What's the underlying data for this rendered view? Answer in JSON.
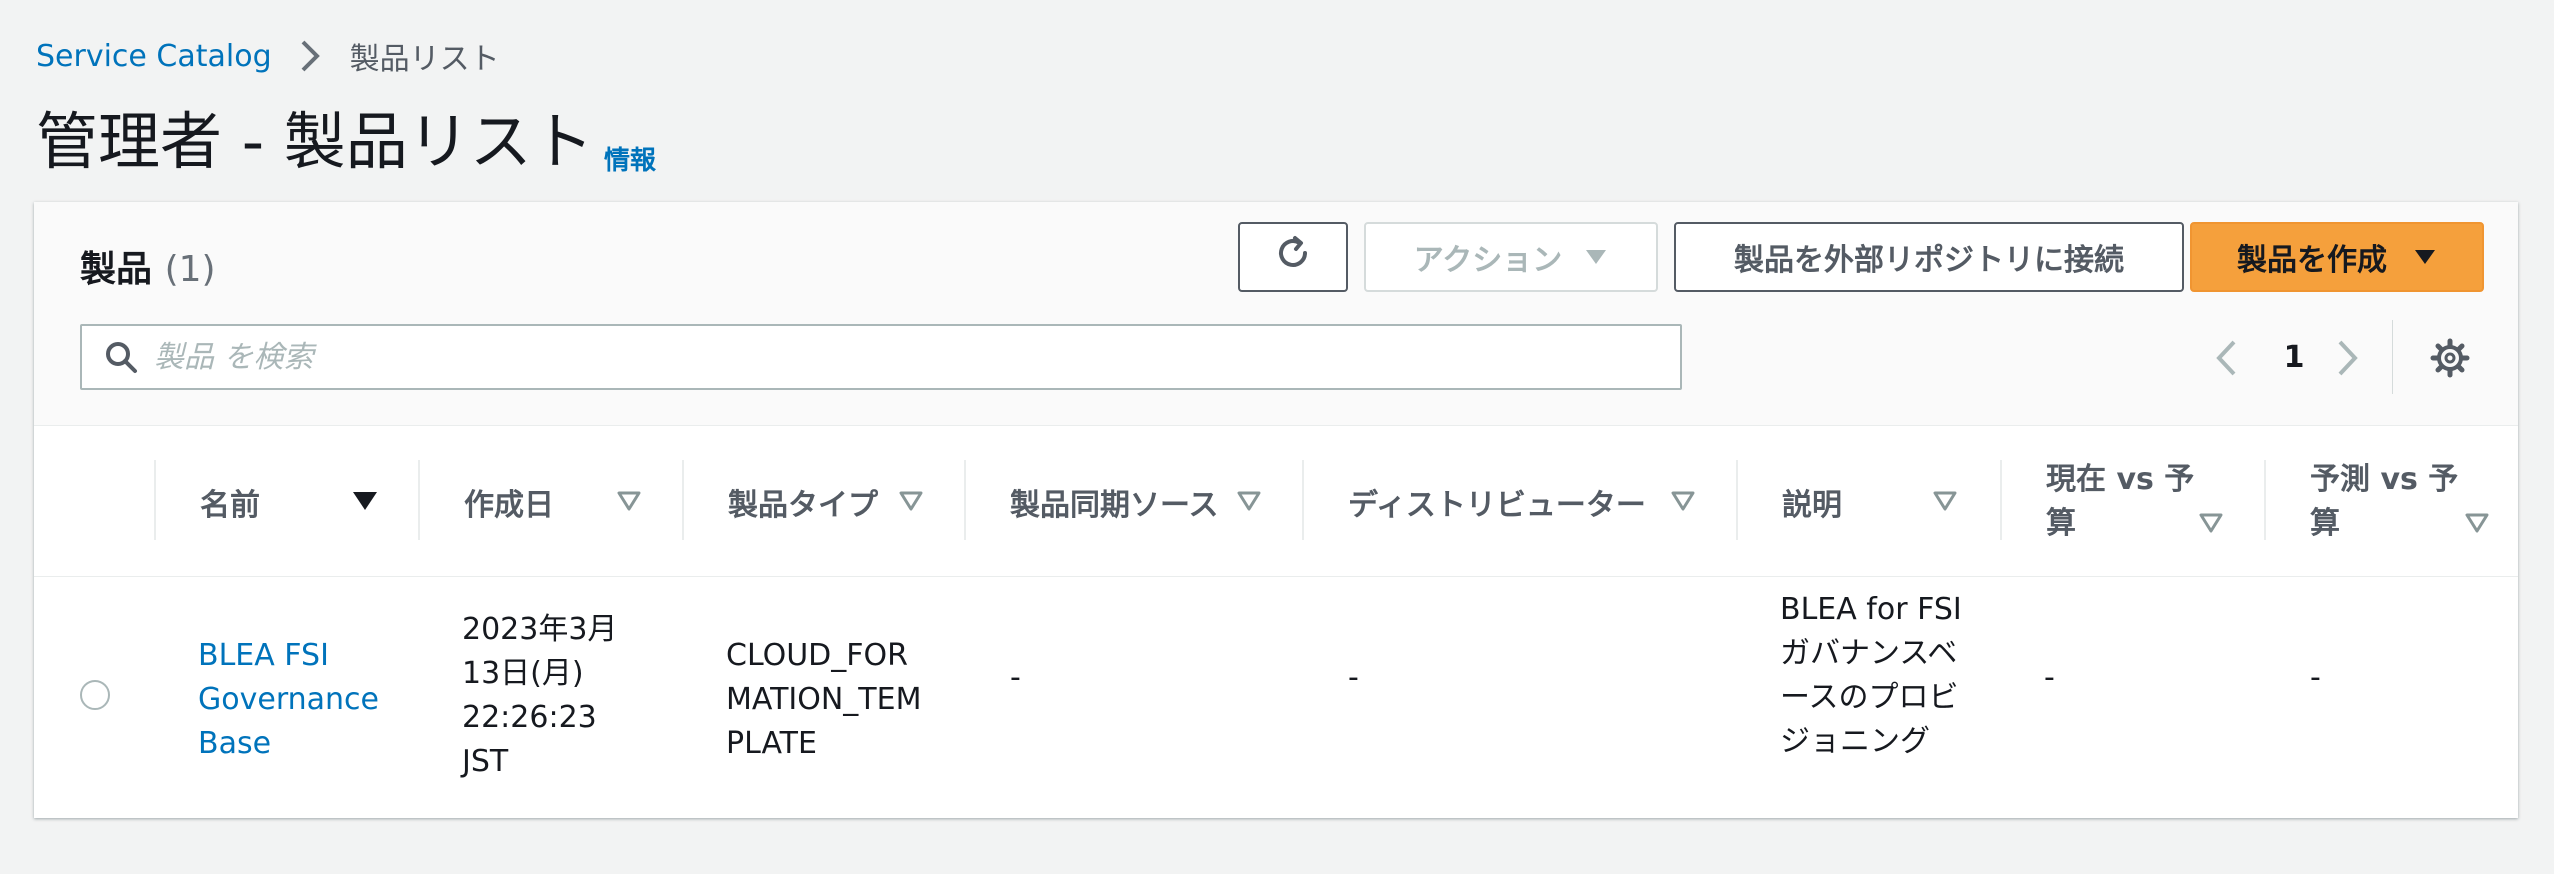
{
  "breadcrumb": {
    "root": "Service Catalog",
    "current": "製品リスト"
  },
  "page": {
    "title": "管理者 - 製品リスト",
    "info": "情報"
  },
  "products": {
    "title": "製品",
    "count": "(1)",
    "actions": {
      "action_label": "アクション",
      "connect_label": "製品を外部リポジトリに接続",
      "create_label": "製品を作成"
    },
    "search": {
      "placeholder": "製品 を検索"
    },
    "pagination": {
      "current_page": "1"
    },
    "columns": [
      {
        "label": "名前",
        "sorted": "descending"
      },
      {
        "label": "作成日"
      },
      {
        "label": "製品タイプ"
      },
      {
        "label": "製品同期ソース"
      },
      {
        "label": "ディストリビューター"
      },
      {
        "label": "説明"
      },
      {
        "label": "現在 vs 予算"
      },
      {
        "label": "予測 vs 予算"
      }
    ],
    "rows": [
      {
        "name": "BLEA FSI Governance Base",
        "created": "2023年3月13日(月) 22:26:23 JST",
        "type": "CLOUD_FORMATION_TEMPLATE",
        "sync_source": "-",
        "distributor": "-",
        "description": "BLEA for FSI ガバナンスベースのプロビジョニング",
        "current_vs_budget": "-",
        "forecast_vs_budget": "-",
        "selected": false
      }
    ]
  },
  "colors": {
    "link": "#0073bb",
    "primary_button": "#f5a03c",
    "page_background": "#f2f3f3",
    "text": "#16191f",
    "muted_text": "#545b64"
  }
}
